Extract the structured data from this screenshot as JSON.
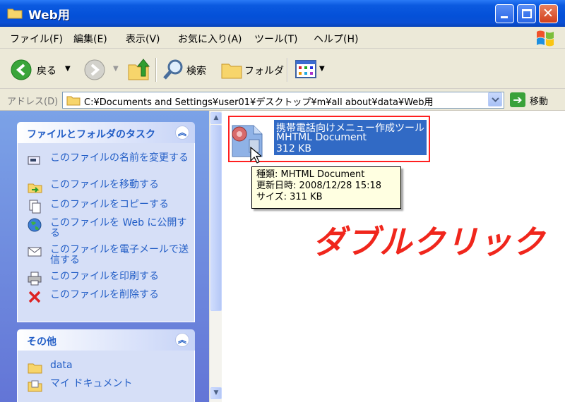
{
  "window": {
    "title": "Web用"
  },
  "menu": {
    "items": [
      "ファイル(F)",
      "編集(E)",
      "表示(V)",
      "お気に入り(A)",
      "ツール(T)",
      "ヘルプ(H)"
    ]
  },
  "toolbar": {
    "back_label": "戻る",
    "search_label": "検索",
    "folders_label": "フォルダ"
  },
  "address": {
    "label": "アドレス(D)",
    "path": "C:¥Documents and Settings¥user01¥デスクトップ¥m¥all about¥data¥Web用",
    "go_label": "移動"
  },
  "tasks_panel": {
    "title": "ファイルとフォルダのタスク",
    "items": [
      {
        "label": "このファイルの名前を変更する",
        "icon": "rename-icon"
      },
      {
        "label": "このファイルを移動する",
        "icon": "move-icon"
      },
      {
        "label": "このファイルをコピーする",
        "icon": "copy-icon"
      },
      {
        "label": "このファイルを Web に公開する",
        "icon": "globe-icon"
      },
      {
        "label": "このファイルを電子メールで送信する",
        "icon": "email-icon"
      },
      {
        "label": "このファイルを印刷する",
        "icon": "printer-icon"
      },
      {
        "label": "このファイルを削除する",
        "icon": "delete-icon"
      }
    ]
  },
  "other_panel": {
    "title": "その他",
    "items": [
      {
        "label": "data",
        "icon": "folder-icon"
      },
      {
        "label": "マイ ドキュメント",
        "icon": "my-documents-icon"
      }
    ]
  },
  "file": {
    "name": "携帯電話向けメニュー作成ツール",
    "type": "MHTML Document",
    "size": "312 KB"
  },
  "tooltip": {
    "line1": "種類: MHTML Document",
    "line2": "更新日時: 2008/12/28 15:18",
    "line3": "サイズ: 311 KB"
  },
  "annotation": {
    "text": "ダブルクリック"
  },
  "colors": {
    "titlebar": "#0450d8",
    "selection": "#316ac5",
    "annotation": "#f0261c",
    "highlight_border": "#ff1f1f"
  }
}
